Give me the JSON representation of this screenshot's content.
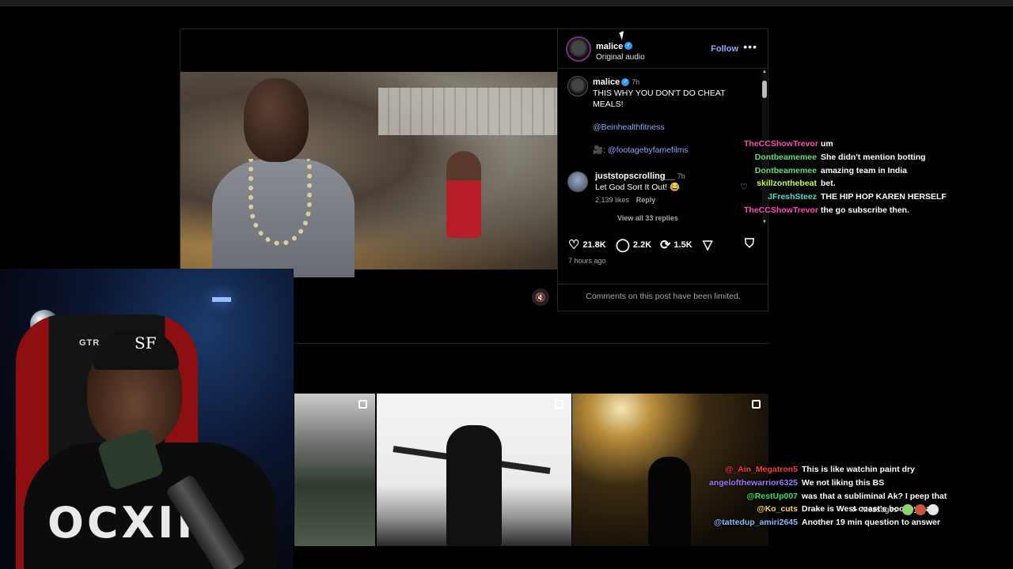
{
  "post": {
    "header": {
      "username": "malice",
      "subtitle": "Original audio",
      "follow_label": "Follow",
      "more_label": "•••"
    },
    "caption": {
      "username": "malice",
      "time": "7h",
      "text": "THIS WHY YOU DON'T DO CHEAT MEALS!",
      "mention1": "@Beinhealthfitness",
      "camera_icon": "🎥",
      "mention2": ": @footagebyfamefilms"
    },
    "comment": {
      "username": "juststopscrolling__",
      "time": "7h",
      "text": "Let God Sort It Out! 😂",
      "likes": "2,139 likes",
      "reply": "Reply",
      "view_replies": "View all 33 replies"
    },
    "actions": {
      "likes": "21.8K",
      "comments": "2.2K",
      "reposts": "1.5K"
    },
    "posted_ago": "7 hours ago",
    "limited_notice": "Comments on this post have been limited.",
    "mute_icon": "🔇"
  },
  "webcam": {
    "chair_brand": "GTR",
    "hat_logo": "SF",
    "shirt_text": "OCXII"
  },
  "chat_top": [
    {
      "user": "TheCCShowTrevor",
      "color": "#ff4fb3",
      "message": "um"
    },
    {
      "user": "Dontbeamemee",
      "color": "#62e07a",
      "message": "She didn't mention botting"
    },
    {
      "user": "Dontbeamemee",
      "color": "#62e07a",
      "message": "amazing team in India"
    },
    {
      "user": "skillzonthebeat",
      "color": "#c6ff3a",
      "message": "bet."
    },
    {
      "user": "JFreshSteez",
      "color": "#4fe0c8",
      "message": "THE HIP HOP KAREN HERSELF"
    },
    {
      "user": "TheCCShowTrevor",
      "color": "#ff4fb3",
      "message": "the go subscribe then."
    }
  ],
  "chat_bottom": [
    {
      "user": "@_Ain_Megatron5",
      "color": "#ff3b3b",
      "message": "This is like watchin paint dry"
    },
    {
      "user": "angelofthewarrior6325",
      "color": "#9c7bff",
      "message": "We not liking this BS"
    },
    {
      "user": "@RestUp007",
      "color": "#35e06b",
      "message": "was that a subliminal Ak? I peep that"
    },
    {
      "user": "@Ko_cuts",
      "color": "#ffd23f",
      "message": "Drake is West coast's boogeyman"
    },
    {
      "user": "@tattedup_amiri2645",
      "color": "#8fb8ff",
      "message": "Another 19 min question to answer"
    }
  ],
  "messages_label": "Messages"
}
